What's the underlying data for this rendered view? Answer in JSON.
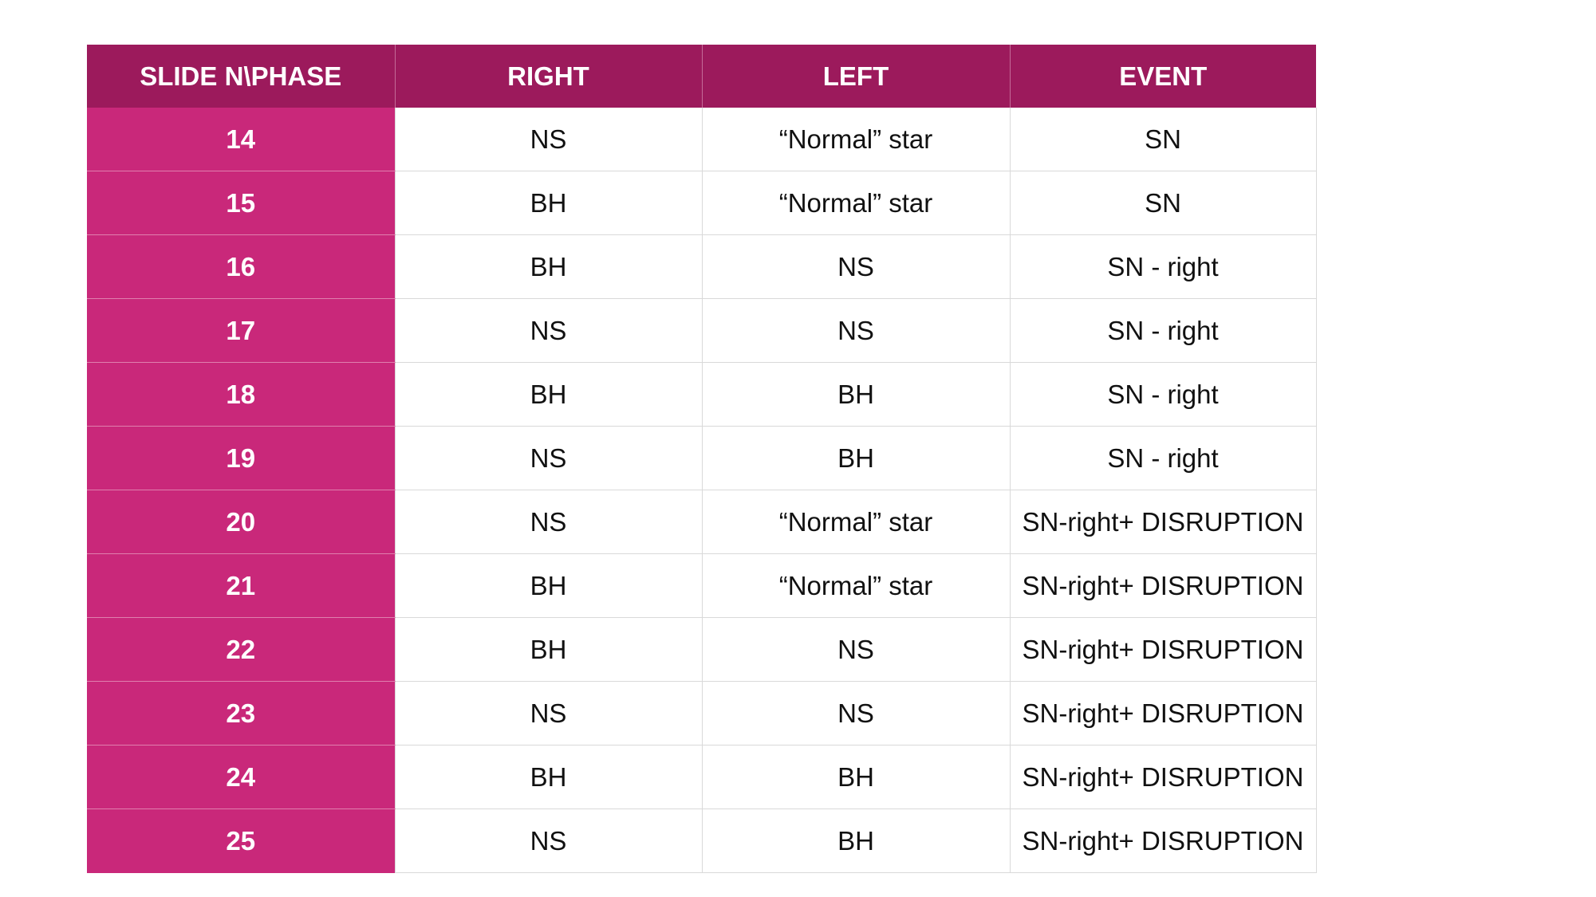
{
  "colors": {
    "header_bg": "#9c1a5c",
    "slide_column_bg": "#c9287a",
    "cell_bg": "#ffffff",
    "grid_line": "#d9d9d9"
  },
  "table": {
    "headers": [
      "SLIDE N\\PHASE",
      "RIGHT",
      "LEFT",
      "EVENT"
    ],
    "rows": [
      [
        "14",
        "NS",
        "“Normal” star",
        "SN"
      ],
      [
        "15",
        "BH",
        "“Normal” star",
        "SN"
      ],
      [
        "16",
        "BH",
        "NS",
        "SN - right"
      ],
      [
        "17",
        "NS",
        "NS",
        "SN - right"
      ],
      [
        "18",
        "BH",
        "BH",
        "SN - right"
      ],
      [
        "19",
        "NS",
        "BH",
        "SN - right"
      ],
      [
        "20",
        "NS",
        "“Normal” star",
        "SN-right+ DISRUPTION"
      ],
      [
        "21",
        "BH",
        "“Normal” star",
        "SN-right+ DISRUPTION"
      ],
      [
        "22",
        "BH",
        "NS",
        "SN-right+ DISRUPTION"
      ],
      [
        "23",
        "NS",
        "NS",
        "SN-right+ DISRUPTION"
      ],
      [
        "24",
        "BH",
        "BH",
        "SN-right+ DISRUPTION"
      ],
      [
        "25",
        "NS",
        "BH",
        "SN-right+ DISRUPTION"
      ]
    ]
  }
}
